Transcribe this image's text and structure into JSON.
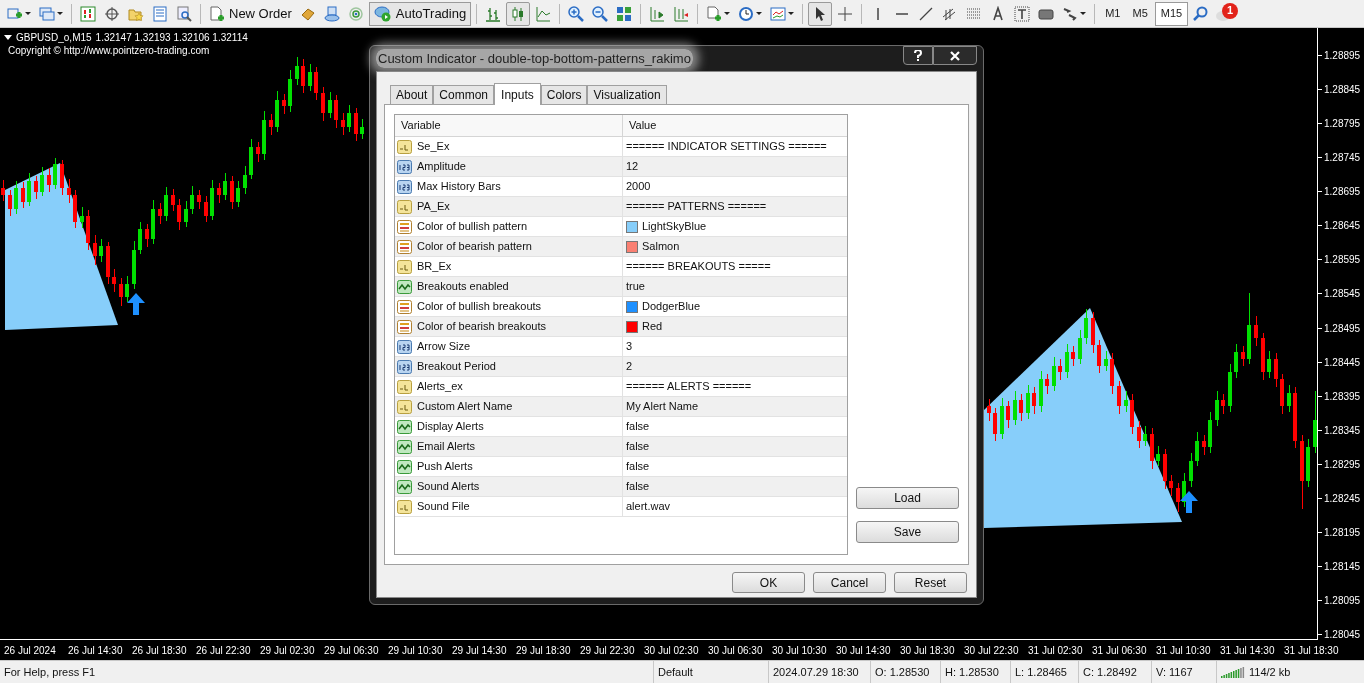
{
  "toolbar": {
    "buttons": [
      {
        "label": "New Order",
        "pressed": false
      },
      {
        "label": "AutoTrading",
        "pressed": true
      }
    ],
    "timeframes": [
      {
        "label": "M1",
        "selected": false
      },
      {
        "label": "M5",
        "selected": false
      },
      {
        "label": "M15",
        "selected": true
      }
    ],
    "notification_count": "1"
  },
  "chart": {
    "symbol": "GBPUSD_o,M15",
    "quote": "1.32147 1.32193 1.32106 1.32114",
    "copyright": "Copyright © http://www.pointzero-trading.com",
    "chart_data": {
      "type": "candlestick",
      "ylim": [
        1.28039,
        1.28935
      ],
      "categories": [
        null,
        null,
        null,
        null,
        null,
        null,
        null,
        null,
        null,
        null,
        null,
        null,
        null,
        null,
        null,
        null,
        null,
        null,
        null,
        null,
        null,
        null,
        null,
        null,
        null,
        null,
        null,
        null,
        null,
        null,
        null,
        null,
        null,
        null,
        null,
        null,
        null,
        null,
        null,
        null,
        null,
        null,
        null,
        null,
        null,
        null,
        null,
        null,
        null,
        null,
        null,
        null,
        null,
        null,
        null,
        null,
        null,
        null,
        null,
        null,
        null,
        null,
        null,
        null,
        null,
        null,
        null,
        null,
        null,
        null,
        null,
        null,
        null,
        null,
        null,
        null,
        null,
        null,
        null,
        null,
        null,
        null,
        null,
        null,
        null,
        null,
        null,
        null,
        null,
        null,
        null,
        null,
        null,
        null,
        null,
        null,
        null,
        null,
        null,
        null,
        null,
        null,
        null,
        null,
        null,
        null,
        null,
        null,
        null,
        null,
        null,
        null,
        null,
        null,
        null,
        null,
        null,
        null,
        null,
        null,
        null,
        null,
        null,
        null,
        null,
        null,
        null,
        null,
        null,
        null,
        null,
        null,
        null,
        null,
        null,
        null,
        null,
        null,
        null,
        null,
        null,
        null,
        null,
        null,
        null,
        null,
        null,
        null,
        null,
        null,
        null,
        null,
        null,
        null,
        null,
        null,
        null,
        null,
        null,
        null,
        null,
        null,
        null,
        null,
        null,
        null,
        null,
        null,
        null,
        null,
        null,
        null,
        null,
        null,
        null,
        null,
        null,
        null,
        null,
        null,
        null,
        null,
        null,
        null,
        null,
        null,
        null,
        null,
        null,
        null,
        null,
        null,
        null,
        null,
        null,
        null,
        null,
        null,
        null,
        null,
        null,
        null
      ],
      "yticks": [
        {
          "value": 1.28895,
          "label": "1.28895"
        },
        {
          "value": 1.28845,
          "label": "1.28845"
        },
        {
          "value": 1.28795,
          "label": "1.28795"
        },
        {
          "value": 1.28745,
          "label": "1.28745"
        },
        {
          "value": 1.28695,
          "label": "1.28695"
        },
        {
          "value": 1.28645,
          "label": "1.28645"
        },
        {
          "value": 1.28595,
          "label": "1.28595"
        },
        {
          "value": 1.28545,
          "label": "1.28545"
        },
        {
          "value": 1.28495,
          "label": "1.28495"
        },
        {
          "value": 1.28445,
          "label": "1.28445"
        },
        {
          "value": 1.28395,
          "label": "1.28395"
        },
        {
          "value": 1.28345,
          "label": "1.28345"
        },
        {
          "value": 1.28295,
          "label": "1.28295"
        },
        {
          "value": 1.28245,
          "label": "1.28245"
        },
        {
          "value": 1.28195,
          "label": "1.28195"
        },
        {
          "value": 1.28145,
          "label": "1.28145"
        },
        {
          "value": 1.28095,
          "label": "1.28095"
        },
        {
          "value": 1.28045,
          "label": "1.28045"
        }
      ],
      "ohlc": [
        [
          1.287,
          1.28712,
          1.28681,
          1.2869
        ],
        [
          1.2869,
          1.28698,
          1.2866,
          1.2867
        ],
        [
          1.2867,
          1.28711,
          1.28662,
          1.287
        ],
        [
          1.287,
          1.28709,
          1.28671,
          1.2868
        ],
        [
          1.2868,
          1.28722,
          1.28674,
          1.2871
        ],
        [
          1.2871,
          1.28718,
          1.28684,
          1.28695
        ],
        [
          1.28695,
          1.28731,
          1.28688,
          1.2872
        ],
        [
          1.2872,
          1.28729,
          1.28694,
          1.28705
        ],
        [
          1.28705,
          1.28744,
          1.28699,
          1.28735
        ],
        [
          1.28735,
          1.28741,
          1.2869,
          1.287
        ],
        [
          1.287,
          1.28713,
          1.28678,
          1.2869
        ],
        [
          1.2869,
          1.28697,
          1.28641,
          1.2865
        ],
        [
          1.2865,
          1.28672,
          1.28642,
          1.2866
        ],
        [
          1.2866,
          1.28668,
          1.28609,
          1.2862
        ],
        [
          1.2862,
          1.28631,
          1.28588,
          1.286
        ],
        [
          1.286,
          1.28626,
          1.28592,
          1.28615
        ],
        [
          1.28615,
          1.28621,
          1.28559,
          1.2857
        ],
        [
          1.2857,
          1.28582,
          1.28548,
          1.2856
        ],
        [
          1.2856,
          1.28568,
          1.28528,
          1.2854
        ],
        [
          1.2854,
          1.28571,
          1.28533,
          1.2856
        ],
        [
          1.2856,
          1.28622,
          1.28552,
          1.2861
        ],
        [
          1.2861,
          1.28651,
          1.28603,
          1.2864
        ],
        [
          1.2864,
          1.28648,
          1.28614,
          1.28625
        ],
        [
          1.28625,
          1.28683,
          1.28618,
          1.2867
        ],
        [
          1.2867,
          1.28679,
          1.28648,
          1.2866
        ],
        [
          1.2866,
          1.28702,
          1.28652,
          1.2869
        ],
        [
          1.2869,
          1.28699,
          1.28666,
          1.28675
        ],
        [
          1.28675,
          1.28684,
          1.28639,
          1.2865
        ],
        [
          1.2865,
          1.28681,
          1.28643,
          1.2867
        ],
        [
          1.2867,
          1.28703,
          1.28662,
          1.2869
        ],
        [
          1.2869,
          1.28698,
          1.28669,
          1.2868
        ],
        [
          1.2868,
          1.28689,
          1.28651,
          1.2866
        ],
        [
          1.2866,
          1.28712,
          1.28653,
          1.287
        ],
        [
          1.287,
          1.28708,
          1.28679,
          1.2869
        ],
        [
          1.2869,
          1.28722,
          1.28683,
          1.2871
        ],
        [
          1.2871,
          1.28718,
          1.28669,
          1.2868
        ],
        [
          1.2868,
          1.28711,
          1.28672,
          1.287
        ],
        [
          1.287,
          1.28733,
          1.28692,
          1.2872
        ],
        [
          1.2872,
          1.28772,
          1.28713,
          1.2876
        ],
        [
          1.2876,
          1.28768,
          1.28739,
          1.2875
        ],
        [
          1.2875,
          1.28813,
          1.28742,
          1.288
        ],
        [
          1.288,
          1.28809,
          1.28778,
          1.2879
        ],
        [
          1.2879,
          1.28842,
          1.28783,
          1.2883
        ],
        [
          1.2883,
          1.28838,
          1.28809,
          1.2882
        ],
        [
          1.2882,
          1.28873,
          1.28812,
          1.2886
        ],
        [
          1.2886,
          1.28892,
          1.28851,
          1.2888
        ],
        [
          1.2888,
          1.28889,
          1.28839,
          1.2885
        ],
        [
          1.2885,
          1.28882,
          1.28843,
          1.2887
        ],
        [
          1.2887,
          1.28878,
          1.28829,
          1.2884
        ],
        [
          1.2884,
          1.28848,
          1.28799,
          1.2881
        ],
        [
          1.2881,
          1.28841,
          1.28803,
          1.2883
        ],
        [
          1.2883,
          1.28837,
          1.28789,
          1.288
        ],
        [
          1.288,
          1.28811,
          1.28778,
          1.2879
        ],
        [
          1.2879,
          1.28822,
          1.28782,
          1.2881
        ],
        [
          1.2881,
          1.28818,
          1.28769,
          1.2878
        ],
        [
          1.2878,
          1.28801,
          1.28772,
          1.2879
        ],
        null,
        null,
        null,
        null,
        null,
        null,
        null,
        null,
        null,
        null,
        null,
        null,
        null,
        null,
        null,
        null,
        null,
        null,
        null,
        null,
        null,
        null,
        null,
        null,
        null,
        null,
        null,
        null,
        null,
        null,
        null,
        null,
        null,
        null,
        null,
        null,
        null,
        null,
        null,
        null,
        null,
        null,
        null,
        null,
        null,
        null,
        null,
        null,
        null,
        null,
        null,
        null,
        null,
        null,
        null,
        null,
        null,
        null,
        null,
        null,
        null,
        null,
        null,
        null,
        null,
        null,
        null,
        null,
        null,
        null,
        null,
        null,
        null,
        null,
        null,
        null,
        null,
        null,
        null,
        null,
        null,
        null,
        null,
        null,
        null,
        null,
        null,
        null,
        null,
        null,
        null,
        null,
        null,
        null,
        null,
        [
          1.2838,
          1.28391,
          1.28359,
          1.2837
        ],
        [
          1.2837,
          1.28378,
          1.28329,
          1.2834
        ],
        [
          1.2834,
          1.28392,
          1.28332,
          1.2838
        ],
        [
          1.2838,
          1.28388,
          1.28349,
          1.2836
        ],
        [
          1.2836,
          1.28402,
          1.28353,
          1.2839
        ],
        [
          1.2839,
          1.28398,
          1.28359,
          1.2837
        ],
        [
          1.2837,
          1.28412,
          1.28362,
          1.284
        ],
        [
          1.284,
          1.28409,
          1.28369,
          1.2838
        ],
        [
          1.2838,
          1.28432,
          1.28372,
          1.2842
        ],
        [
          1.2842,
          1.28428,
          1.28399,
          1.2841
        ],
        [
          1.2841,
          1.28452,
          1.28402,
          1.2844
        ],
        [
          1.2844,
          1.28449,
          1.28419,
          1.2843
        ],
        [
          1.2843,
          1.28472,
          1.28422,
          1.2846
        ],
        [
          1.2846,
          1.28468,
          1.28439,
          1.2845
        ],
        [
          1.2845,
          1.28492,
          1.28442,
          1.2848
        ],
        [
          1.2848,
          1.28523,
          1.28472,
          1.2851
        ],
        [
          1.2851,
          1.28519,
          1.28459,
          1.2847
        ],
        [
          1.2847,
          1.28478,
          1.28429,
          1.2844
        ],
        [
          1.2844,
          1.28462,
          1.28432,
          1.2845
        ],
        [
          1.2845,
          1.28458,
          1.28399,
          1.2841
        ],
        [
          1.2841,
          1.28418,
          1.28369,
          1.2838
        ],
        [
          1.2838,
          1.28402,
          1.28372,
          1.2839
        ],
        [
          1.2839,
          1.28398,
          1.28339,
          1.2835
        ],
        [
          1.2835,
          1.28358,
          1.28319,
          1.2833
        ],
        [
          1.2833,
          1.28352,
          1.28322,
          1.2834
        ],
        [
          1.2834,
          1.28348,
          1.28289,
          1.283
        ],
        [
          1.283,
          1.28322,
          1.28292,
          1.2831
        ],
        [
          1.2831,
          1.28318,
          1.28259,
          1.2827
        ],
        [
          1.2827,
          1.28279,
          1.28248,
          1.2826
        ],
        [
          1.2826,
          1.28268,
          1.28225,
          1.2824
        ],
        [
          1.2824,
          1.28282,
          1.28232,
          1.2827
        ],
        [
          1.2827,
          1.28312,
          1.28262,
          1.283
        ],
        [
          1.283,
          1.28342,
          1.28292,
          1.2833
        ],
        [
          1.2833,
          1.28338,
          1.28309,
          1.2832
        ],
        [
          1.2832,
          1.28372,
          1.28312,
          1.2836
        ],
        [
          1.2836,
          1.28402,
          1.28352,
          1.2839
        ],
        [
          1.2839,
          1.28398,
          1.28369,
          1.2838
        ],
        [
          1.2838,
          1.28442,
          1.28372,
          1.2843
        ],
        [
          1.2843,
          1.28472,
          1.28422,
          1.2846
        ],
        [
          1.2846,
          1.28468,
          1.28439,
          1.2845
        ],
        [
          1.2845,
          1.28546,
          1.28442,
          1.285
        ],
        [
          1.285,
          1.28512,
          1.28469,
          1.2848
        ],
        [
          1.2848,
          1.28488,
          1.28419,
          1.2843
        ],
        [
          1.2843,
          1.28462,
          1.28422,
          1.2845
        ],
        [
          1.2845,
          1.28458,
          1.28409,
          1.2842
        ],
        [
          1.2842,
          1.28428,
          1.28369,
          1.2838
        ],
        [
          1.2838,
          1.28412,
          1.28372,
          1.284
        ],
        [
          1.284,
          1.28408,
          1.28319,
          1.2833
        ],
        [
          1.2833,
          1.28338,
          1.28229,
          1.2827
        ],
        [
          1.2827,
          1.28332,
          1.28262,
          1.2832
        ],
        [
          1.2832,
          1.28402,
          1.28312,
          1.2836
        ]
      ]
    },
    "time_axis": [
      "26 Jul 2024",
      "26 Jul 14:30",
      "26 Jul 18:30",
      "26 Jul 22:30",
      "29 Jul 02:30",
      "29 Jul 06:30",
      "29 Jul 10:30",
      "29 Jul 14:30",
      "29 Jul 18:30",
      "29 Jul 22:30",
      "30 Jul 02:30",
      "30 Jul 06:30",
      "30 Jul 10:30",
      "30 Jul 14:30",
      "30 Jul 18:30",
      "30 Jul 22:30",
      "31 Jul 02:30",
      "31 Jul 06:30",
      "31 Jul 10:30",
      "31 Jul 14:30",
      "31 Jul 18:30"
    ]
  },
  "dialog": {
    "title": "Custom Indicator - double-top-bottom-patterns_rakimo",
    "tabs": [
      {
        "label": "About",
        "selected": false
      },
      {
        "label": "Common",
        "selected": false
      },
      {
        "label": "Inputs",
        "selected": true
      },
      {
        "label": "Colors",
        "selected": false
      },
      {
        "label": "Visualization",
        "selected": false
      }
    ],
    "table": {
      "columns": [
        "Variable",
        "Value"
      ],
      "rows": [
        {
          "kind": "string",
          "variable": "Se_Ex",
          "value": "====== INDICATOR SETTINGS ======"
        },
        {
          "kind": "int",
          "variable": "Amplitude",
          "value": "12"
        },
        {
          "kind": "int",
          "variable": "Max History Bars",
          "value": "2000"
        },
        {
          "kind": "string",
          "variable": "PA_Ex",
          "value": "====== PATTERNS ======"
        },
        {
          "kind": "color",
          "variable": "Color of bullish pattern",
          "value": "LightSkyBlue",
          "color": "#87cefa"
        },
        {
          "kind": "color",
          "variable": "Color of bearish pattern",
          "value": "Salmon",
          "color": "#fa8072"
        },
        {
          "kind": "string",
          "variable": "BR_Ex",
          "value": "====== BREAKOUTS ====="
        },
        {
          "kind": "bool",
          "variable": "Breakouts enabled",
          "value": "true"
        },
        {
          "kind": "color",
          "variable": "Color of bullish breakouts",
          "value": "DodgerBlue",
          "color": "#1e90ff"
        },
        {
          "kind": "color",
          "variable": "Color of bearish breakouts",
          "value": "Red",
          "color": "#ff0000"
        },
        {
          "kind": "int",
          "variable": "Arrow Size",
          "value": "3"
        },
        {
          "kind": "int",
          "variable": "Breakout Period",
          "value": "2"
        },
        {
          "kind": "string",
          "variable": "Alerts_ex",
          "value": "====== ALERTS ======"
        },
        {
          "kind": "string",
          "variable": "Custom Alert Name",
          "value": "My Alert Name"
        },
        {
          "kind": "bool",
          "variable": "Display Alerts",
          "value": "false"
        },
        {
          "kind": "bool",
          "variable": "Email Alerts",
          "value": "false"
        },
        {
          "kind": "bool",
          "variable": "Push Alerts",
          "value": "false"
        },
        {
          "kind": "bool",
          "variable": "Sound Alerts",
          "value": "false"
        },
        {
          "kind": "string",
          "variable": "Sound File",
          "value": "alert.wav"
        }
      ]
    },
    "side_buttons": [
      "Load",
      "Save"
    ],
    "buttons": [
      "OK",
      "Cancel",
      "Reset"
    ]
  },
  "status_bar": [
    "For Help, press F1",
    "Default",
    "2024.07.29 18:30",
    "O: 1.28530",
    "H: 1.28530",
    "L: 1.28465",
    "C: 1.28492",
    "V: 1167",
    "114/2 kb"
  ]
}
